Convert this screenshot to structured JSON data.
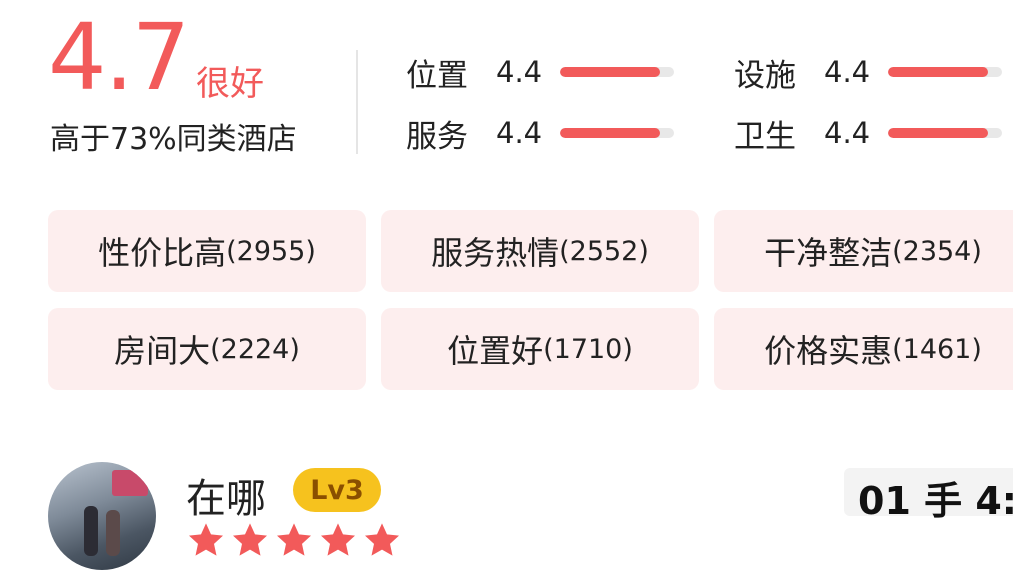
{
  "overall": {
    "score": "4.7",
    "verdict": "很好",
    "comparison": "高于73%同类酒店"
  },
  "subscores": [
    {
      "label": "位置",
      "value": "4.4",
      "fill": 0.88
    },
    {
      "label": "设施",
      "value": "4.4",
      "fill": 0.88
    },
    {
      "label": "服务",
      "value": "4.4",
      "fill": 0.88
    },
    {
      "label": "卫生",
      "value": "4.4",
      "fill": 0.88
    }
  ],
  "tags": [
    {
      "text": "性价比高",
      "count": "(2955)"
    },
    {
      "text": "服务热情",
      "count": "(2552)"
    },
    {
      "text": "干净整洁",
      "count": "(2354)"
    },
    {
      "text": "房间大",
      "count": "(2224)"
    },
    {
      "text": "位置好",
      "count": "(1710)"
    },
    {
      "text": "价格实惠",
      "count": "(1461)"
    }
  ],
  "review": {
    "username": "在哪",
    "level": "Lv3",
    "stars": 5,
    "time_fragment": "01 手 4:"
  },
  "colors": {
    "accent": "#f25a5a",
    "tag_bg": "#fdeeee",
    "level_badge": "#f6c21e"
  }
}
